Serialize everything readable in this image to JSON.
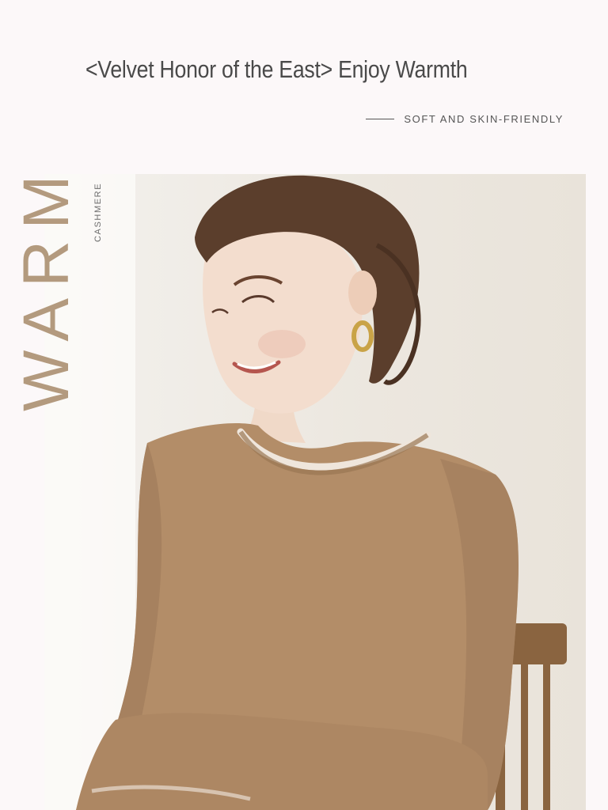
{
  "header": {
    "headline": "<Velvet Honor of the East> Enjoy Warmth",
    "subheadline": "SOFT AND SKIN-FRIENDLY"
  },
  "side": {
    "big_word": "WARM",
    "small_word": "CASHMERE"
  },
  "photo": {
    "subject": "smiling-woman-in-cashmere-sweater"
  },
  "colors": {
    "page_bg": "#fcf8f9",
    "accent_tan": "#b39a7e",
    "sweater": "#b38d68",
    "text_dark": "#4a4a4a"
  }
}
